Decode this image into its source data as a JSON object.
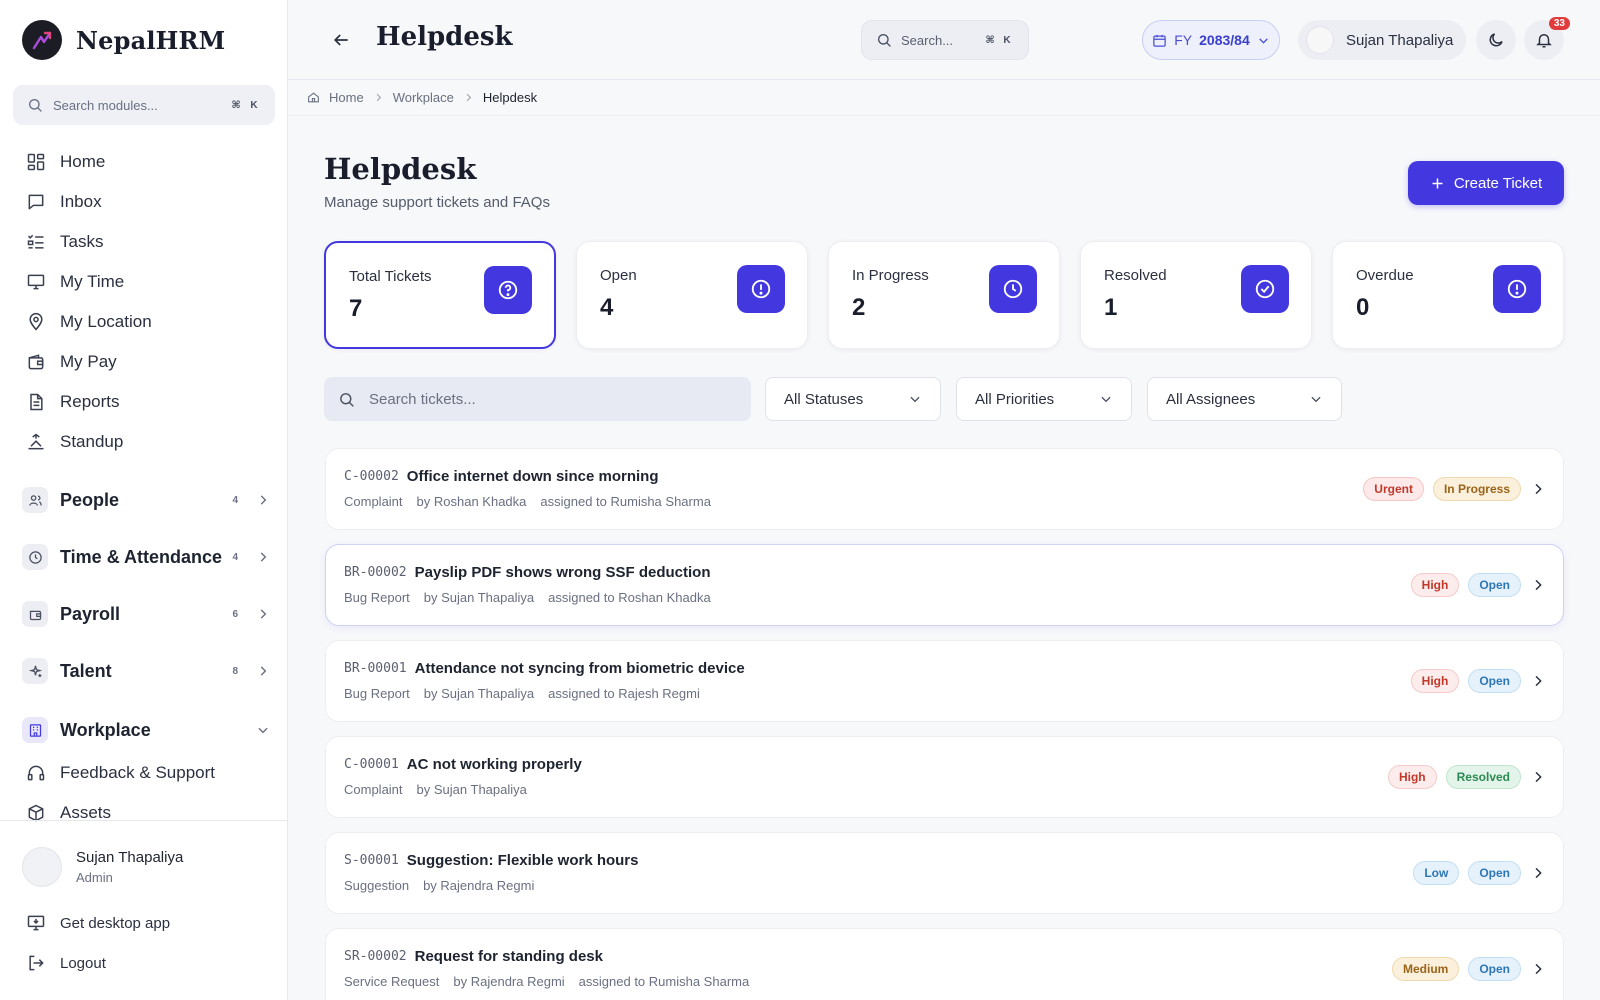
{
  "brand": {
    "name": "NepalHRM"
  },
  "sidebar": {
    "search_placeholder": "Search modules...",
    "kbd": [
      "⌘",
      "K"
    ],
    "items": [
      {
        "label": "Home",
        "icon": "grid-icon"
      },
      {
        "label": "Inbox",
        "icon": "chat-icon"
      },
      {
        "label": "Tasks",
        "icon": "checklist-icon"
      },
      {
        "label": "My Time",
        "icon": "monitor-icon"
      },
      {
        "label": "My Location",
        "icon": "pin-icon"
      },
      {
        "label": "My Pay",
        "icon": "wallet-icon"
      },
      {
        "label": "Reports",
        "icon": "document-icon"
      },
      {
        "label": "Standup",
        "icon": "standup-icon"
      }
    ],
    "groups": [
      {
        "label": "People",
        "count": "4"
      },
      {
        "label": "Time & Attendance",
        "count": "4"
      },
      {
        "label": "Payroll",
        "count": "6"
      },
      {
        "label": "Talent",
        "count": "8"
      },
      {
        "label": "Workplace",
        "count": ""
      }
    ],
    "workplace_items": [
      {
        "label": "Feedback & Support",
        "icon": "headset-icon"
      },
      {
        "label": "Assets",
        "icon": "box-icon"
      }
    ],
    "user": {
      "name": "Sujan Thapaliya",
      "role": "Admin"
    },
    "footer_links": [
      "Get desktop app",
      "Logout"
    ]
  },
  "header": {
    "title": "Helpdesk",
    "search_placeholder": "Search...",
    "kbd": [
      "⌘",
      "K"
    ],
    "fy_prefix": "FY",
    "fy_value": "2083/84",
    "user_name": "Sujan Thapaliya",
    "notification_count": "33"
  },
  "breadcrumb": [
    "Home",
    "Workplace",
    "Helpdesk"
  ],
  "page": {
    "title": "Helpdesk",
    "subtitle": "Manage support tickets and FAQs",
    "create_label": "Create Ticket"
  },
  "stats": [
    {
      "label": "Total Tickets",
      "value": "7",
      "icon": "question-icon"
    },
    {
      "label": "Open",
      "value": "4",
      "icon": "alert-icon"
    },
    {
      "label": "In Progress",
      "value": "2",
      "icon": "clock-icon"
    },
    {
      "label": "Resolved",
      "value": "1",
      "icon": "check-icon"
    },
    {
      "label": "Overdue",
      "value": "0",
      "icon": "alert-icon"
    }
  ],
  "filters": {
    "search_placeholder": "Search tickets...",
    "status": "All Statuses",
    "priority": "All Priorities",
    "assignee": "All Assignees"
  },
  "tickets": [
    {
      "code": "C-00002",
      "title": "Office internet down since morning",
      "type": "Complaint",
      "by": "by Roshan Khadka",
      "assigned": "assigned to Rumisha Sharma",
      "priority": "Urgent",
      "status": "In Progress"
    },
    {
      "code": "BR-00002",
      "title": "Payslip PDF shows wrong SSF deduction",
      "type": "Bug Report",
      "by": "by Sujan Thapaliya",
      "assigned": "assigned to Roshan Khadka",
      "priority": "High",
      "status": "Open"
    },
    {
      "code": "BR-00001",
      "title": "Attendance not syncing from biometric device",
      "type": "Bug Report",
      "by": "by Sujan Thapaliya",
      "assigned": "assigned to Rajesh Regmi",
      "priority": "High",
      "status": "Open"
    },
    {
      "code": "C-00001",
      "title": "AC not working properly",
      "type": "Complaint",
      "by": "by Sujan Thapaliya",
      "assigned": "",
      "priority": "High",
      "status": "Resolved"
    },
    {
      "code": "S-00001",
      "title": "Suggestion: Flexible work hours",
      "type": "Suggestion",
      "by": "by Rajendra Regmi",
      "assigned": "",
      "priority": "Low",
      "status": "Open"
    },
    {
      "code": "SR-00002",
      "title": "Request for standing desk",
      "type": "Service Request",
      "by": "by Rajendra Regmi",
      "assigned": "assigned to Rumisha Sharma",
      "priority": "Medium",
      "status": "Open"
    }
  ]
}
